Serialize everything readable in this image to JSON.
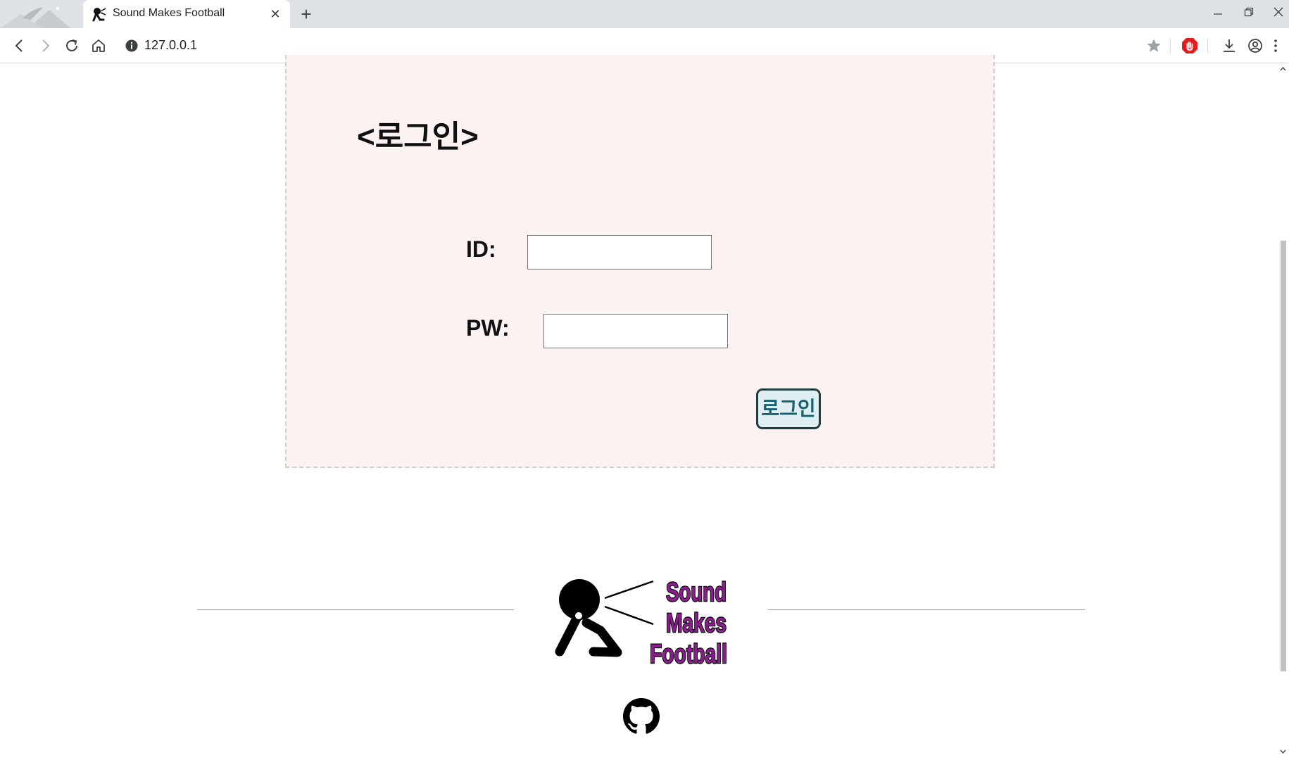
{
  "browser": {
    "tab_title": "Sound Makes Football",
    "url": "127.0.0.1",
    "icons": {
      "back": "back-arrow-icon",
      "forward": "forward-arrow-icon",
      "reload": "reload-icon",
      "home": "home-icon",
      "site_info": "info-icon",
      "bookmark": "star-icon",
      "extension": "stop-hand-icon",
      "download": "download-icon",
      "profile": "profile-icon",
      "menu": "kebab-menu-icon"
    }
  },
  "login": {
    "title": "<로그인>",
    "id_label": "ID:",
    "id_value": "",
    "pw_label": "PW:",
    "pw_value": "",
    "submit_label": "로그인"
  },
  "footer": {
    "logo_text": [
      "Sound",
      "Makes",
      "Football"
    ],
    "github_icon": "github-icon"
  },
  "colors": {
    "login_box_bg": "#fcf2f2",
    "button_bg": "#dfeef0",
    "button_text": "#1a6270",
    "logo_text_fill": "#8a1e8c",
    "chrome_tabstrip": "#dee1e6"
  }
}
